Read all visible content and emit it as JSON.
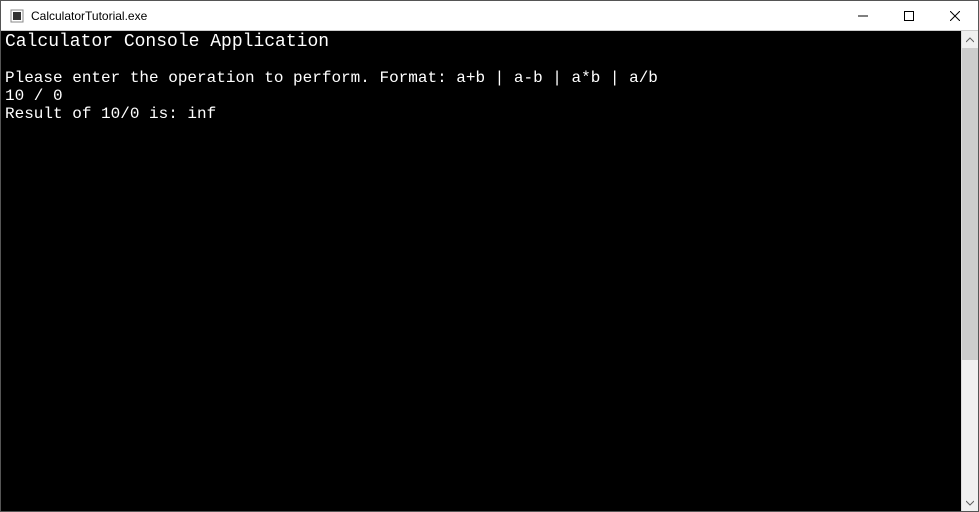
{
  "window": {
    "title": "CalculatorTutorial.exe"
  },
  "console": {
    "header": "Calculator Console Application",
    "blank": "",
    "prompt": "Please enter the operation to perform. Format: a+b | a-b | a*b | a/b",
    "input": "10 / 0",
    "result": "Result of 10/0 is: inf"
  }
}
